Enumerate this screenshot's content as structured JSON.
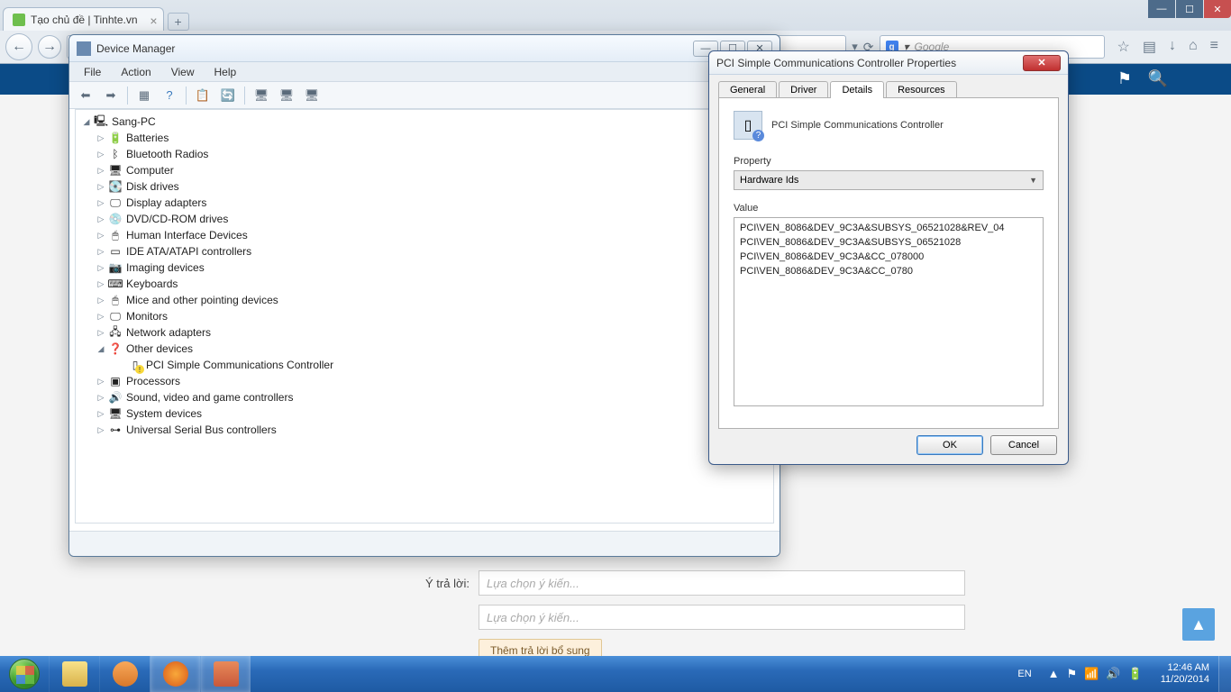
{
  "browser": {
    "tab_title": "Tạo chủ đề | Tinhte.vn",
    "search_placeholder": "Google",
    "win_min": "—",
    "win_max": "☐",
    "win_close": "✕"
  },
  "form": {
    "reply_label": "Ý trả lời:",
    "opinion_placeholder": "Lựa chọn ý kiến...",
    "opinion_placeholder2": "Lựa chọn ý kiến...",
    "add_more": "Thêm trả lời bổ sung"
  },
  "device_manager": {
    "title": "Device Manager",
    "menu": {
      "file": "File",
      "action": "Action",
      "view": "View",
      "help": "Help"
    },
    "root": "Sang-PC",
    "categories": [
      {
        "label": "Batteries",
        "icon": "🔋"
      },
      {
        "label": "Bluetooth Radios",
        "icon": "ᛒ"
      },
      {
        "label": "Computer",
        "icon": "🖥"
      },
      {
        "label": "Disk drives",
        "icon": "💽"
      },
      {
        "label": "Display adapters",
        "icon": "🖵"
      },
      {
        "label": "DVD/CD-ROM drives",
        "icon": "💿"
      },
      {
        "label": "Human Interface Devices",
        "icon": "🖱"
      },
      {
        "label": "IDE ATA/ATAPI controllers",
        "icon": "▭"
      },
      {
        "label": "Imaging devices",
        "icon": "📷"
      },
      {
        "label": "Keyboards",
        "icon": "⌨"
      },
      {
        "label": "Mice and other pointing devices",
        "icon": "🖱"
      },
      {
        "label": "Monitors",
        "icon": "🖵"
      },
      {
        "label": "Network adapters",
        "icon": "🖧"
      },
      {
        "label": "Other devices",
        "icon": "❓",
        "expanded": true
      },
      {
        "label": "Processors",
        "icon": "▣"
      },
      {
        "label": "Sound, video and game controllers",
        "icon": "🔊"
      },
      {
        "label": "System devices",
        "icon": "🖥"
      },
      {
        "label": "Universal Serial Bus controllers",
        "icon": "⊶"
      }
    ],
    "other_device_child": "PCI Simple Communications Controller"
  },
  "properties": {
    "title": "PCI Simple Communications Controller Properties",
    "tabs": {
      "general": "General",
      "driver": "Driver",
      "details": "Details",
      "resources": "Resources"
    },
    "device_label": "PCI Simple Communications Controller",
    "property_label": "Property",
    "property_selected": "Hardware Ids",
    "value_label": "Value",
    "values": [
      "PCI\\VEN_8086&DEV_9C3A&SUBSYS_06521028&REV_04",
      "PCI\\VEN_8086&DEV_9C3A&SUBSYS_06521028",
      "PCI\\VEN_8086&DEV_9C3A&CC_078000",
      "PCI\\VEN_8086&DEV_9C3A&CC_0780"
    ],
    "ok": "OK",
    "cancel": "Cancel"
  },
  "taskbar": {
    "lang": "EN",
    "time": "12:46 AM",
    "date": "11/20/2014"
  }
}
